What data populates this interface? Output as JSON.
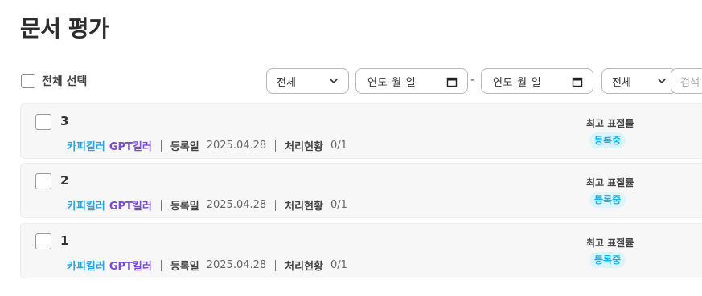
{
  "page": {
    "title": "문서 평가"
  },
  "toolbar": {
    "select_all_label": "전체 선택",
    "type_filter": {
      "selected": "전체"
    },
    "date_start": {
      "value": "연도-월-일"
    },
    "date_separator": "-",
    "date_end": {
      "value": "연도-월-일"
    },
    "status_filter": {
      "selected": "전체"
    },
    "search": {
      "placeholder": "검색"
    }
  },
  "documents": [
    {
      "title": "3",
      "tag_copy": "카피킬러",
      "tag_gpt": "GPT킬러",
      "registered_label": "등록일",
      "registered_date": "2025.04.28",
      "progress_label": "처리현황",
      "progress_value": "0/1",
      "score_label": "최고 표절률",
      "status": "등록중"
    },
    {
      "title": "2",
      "tag_copy": "카피킬러",
      "tag_gpt": "GPT킬러",
      "registered_label": "등록일",
      "registered_date": "2025.04.28",
      "progress_label": "처리현황",
      "progress_value": "0/1",
      "score_label": "최고 표절률",
      "status": "등록중"
    },
    {
      "title": "1",
      "tag_copy": "카피킬러",
      "tag_gpt": "GPT킬러",
      "registered_label": "등록일",
      "registered_date": "2025.04.28",
      "progress_label": "처리현황",
      "progress_value": "0/1",
      "score_label": "최고 표절률",
      "status": "등록중"
    }
  ],
  "icons": {
    "dropdown": "chevron-down-icon",
    "date": "calendar-icon",
    "checkbox": "checkbox-icon"
  },
  "colors": {
    "copykiller_tag": "#2aa6e0",
    "gptkiller_tag": "#7b4bd6",
    "status_badge_bg": "#dcf4fc",
    "status_badge_text": "#1bb1e6",
    "row_bg": "#f7f7f7"
  }
}
